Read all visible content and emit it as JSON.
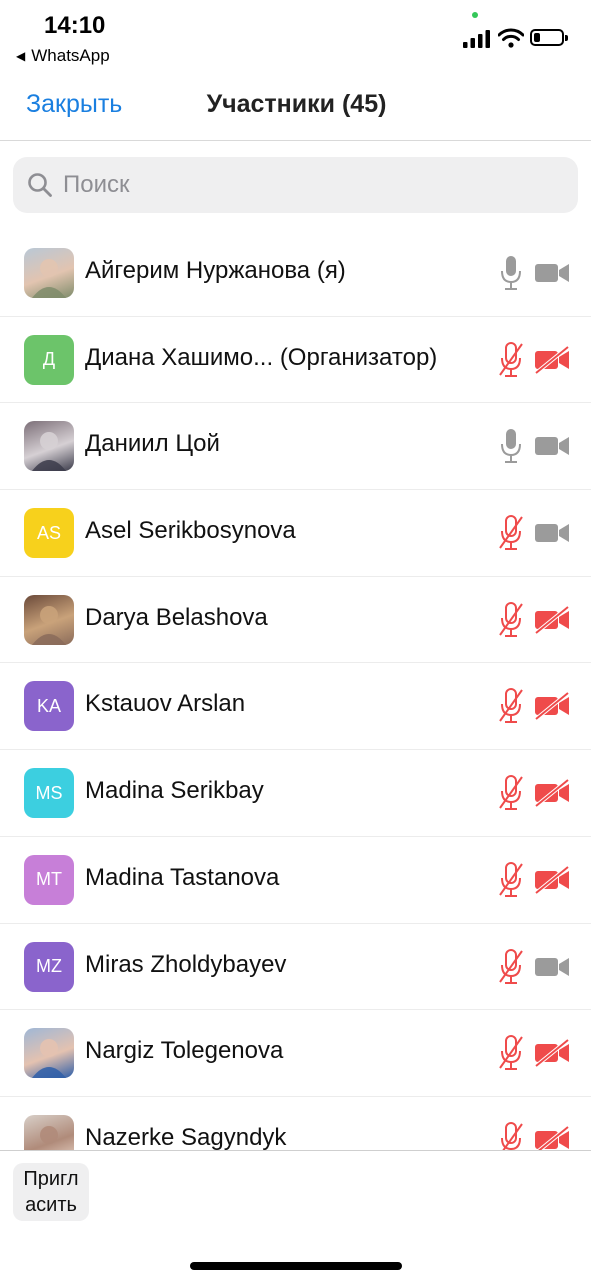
{
  "status": {
    "time": "14:10",
    "back_app": "WhatsApp"
  },
  "nav": {
    "close_label": "Закрыть",
    "title": "Участники (45)"
  },
  "search": {
    "placeholder": "Поиск"
  },
  "colors": {
    "accent": "#1a7fe0",
    "muted_icon": "#9b9b9b",
    "muted_red": "#ef4b4b"
  },
  "participants": [
    {
      "name": "Айгерим Нуржанова (я)",
      "avatar": "photo",
      "mic": "on",
      "cam": "on"
    },
    {
      "name": "Диана Хашимо... (Организатор)",
      "avatar": "Д",
      "avatar_color": "#6cc46a",
      "mic": "off",
      "cam": "off"
    },
    {
      "name": "Даниил Цой",
      "avatar": "photo",
      "mic": "on",
      "cam": "on"
    },
    {
      "name": "Asel Serikbosynova",
      "avatar": "AS",
      "avatar_color": "#f7d11c",
      "mic": "off",
      "cam": "on"
    },
    {
      "name": "Darya Belashova",
      "avatar": "photo",
      "mic": "off",
      "cam": "off"
    },
    {
      "name": "Kstauov Arslan",
      "avatar": "KA",
      "avatar_color": "#8a64cc",
      "mic": "off",
      "cam": "off"
    },
    {
      "name": "Madina Serikbay",
      "avatar": "MS",
      "avatar_color": "#3ccfe0",
      "mic": "off",
      "cam": "off"
    },
    {
      "name": "Madina Tastanova",
      "avatar": "MT",
      "avatar_color": "#c77fd8",
      "mic": "off",
      "cam": "off"
    },
    {
      "name": "Miras Zholdybayev",
      "avatar": "MZ",
      "avatar_color": "#8a64cc",
      "mic": "off",
      "cam": "on"
    },
    {
      "name": "Nargiz Tolegenova",
      "avatar": "photo",
      "mic": "off",
      "cam": "off"
    },
    {
      "name": "Nazerke Sagyndyk",
      "avatar": "photo",
      "mic": "off",
      "cam": "off"
    }
  ],
  "bottom": {
    "invite_line1": "Пригл",
    "invite_line2": "асить"
  }
}
